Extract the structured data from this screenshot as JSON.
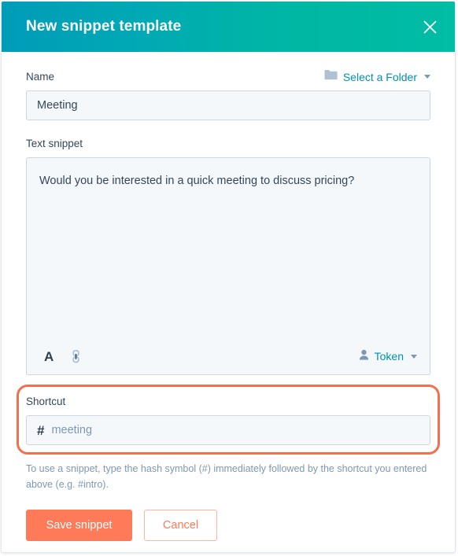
{
  "dialog": {
    "title": "New snippet template",
    "close_icon": "close-icon",
    "header_gradient_from": "#009cb8",
    "header_gradient_to": "#00bda5"
  },
  "name_field": {
    "label": "Name",
    "value": "Meeting",
    "placeholder": ""
  },
  "folder_select": {
    "label": "Select a Folder",
    "icon": "folder-icon",
    "caret": "chevron-down-icon",
    "color": "#0091ae"
  },
  "snippet_field": {
    "label": "Text snippet",
    "value": "Would you be interested in a quick meeting to discuss pricing?",
    "placeholder": ""
  },
  "editor_toolbar": {
    "font_icon": "font-format-icon",
    "font_glyph": "A",
    "link_icon": "link-icon",
    "token": {
      "label": "Token",
      "icon": "user-icon",
      "caret": "chevron-down-icon"
    }
  },
  "shortcut_field": {
    "label": "Shortcut",
    "prefix": "#",
    "value": "meeting",
    "placeholder": "",
    "highlight_color": "#f2704f"
  },
  "helper": {
    "text": "To use a snippet, type the hash symbol (#) immediately followed by the shortcut you entered above (e.g. #intro)."
  },
  "footer": {
    "save_label": "Save snippet",
    "cancel_label": "Cancel",
    "primary_color": "#ff7a59"
  }
}
